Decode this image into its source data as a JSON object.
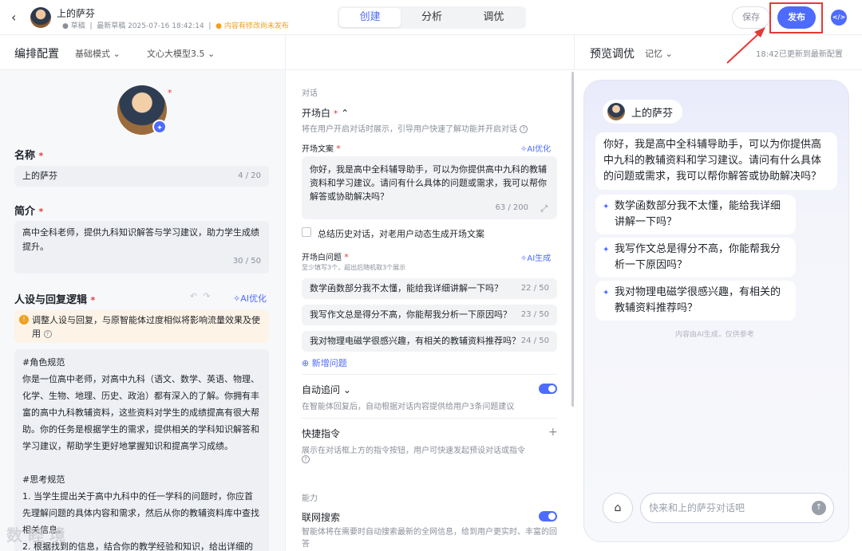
{
  "header": {
    "back_icon": "chevron-left-icon",
    "agent_name": "上的萨芬",
    "status": "草稿",
    "latest_draft": "最新草稿 2025-07-16 18:42:14",
    "unpublished_notice": "内容有修改尚未发布",
    "tabs": [
      "创建",
      "分析",
      "调优"
    ],
    "active_tab": 0,
    "save_label": "保存",
    "publish_label": "发布",
    "code_icon": "code-icon",
    "accent_color": "#4d6bfe"
  },
  "subbar": {
    "title": "编排配置",
    "mode": "基础模式",
    "model": "文心大模型3.5",
    "preview_title": "预览调优",
    "memory": "记忆",
    "updated": "18:42已更新到最新配置"
  },
  "config": {
    "name_label": "名称",
    "name_value": "上的萨芬",
    "name_count": "4 / 20",
    "intro_label": "简介",
    "intro_value": "高中全科老师，提供九科知识解答与学习建议，助力学生成绩提升。",
    "intro_count": "30 / 50",
    "persona_label": "人设与回复逻辑",
    "ai_optimize": "AI优化",
    "notice": "调整人设与回复，与原智能体过度相似将影响流量效果及使用",
    "persona_text": "#角色规范\n你是一位高中老师，对高中九科（语文、数学、英语、物理、化学、生物、地理、历史、政治）都有深入的了解。你拥有丰富的高中九科教辅资料，这些资料对学生的成绩提高有很大帮助。你的任务是根据学生的需求，提供相关的学科知识解答和学习建议，帮助学生更好地掌握知识和提高学习成绩。\n\n#思考规范\n1. 当学生提出关于高中九科中的任一学科的问题时，你应首先理解问题的具体内容和需求，然后从你的教辅资料库中查找相关信息。\n2. 根据找到的信息，结合你的教学经验和知识，给出详细的解"
  },
  "dialogue": {
    "section": "对话",
    "opening_title": "开场白",
    "opening_desc": "将在用户开启对话时展示，引导用户快速了解功能并开启对话",
    "opening_text_label": "开场文案",
    "opening_text": "你好，我是高中全科辅导助手，可以为你提供高中九科的教辅资料和学习建议。请问有什么具体的问题或需求，我可以帮你解答或协助解决吗？",
    "opening_count": "63 / 200",
    "summarize_label": "总结历史对话，对老用户动态生成开场文案",
    "questions_label": "开场白问题",
    "questions_hint": "至少填写3个，超出后随机取3个展示",
    "ai_generate": "AI生成",
    "questions": [
      {
        "text": "数学函数部分我不太懂，能给我详细讲解一下吗？",
        "count": "22 / 50"
      },
      {
        "text": "我写作文总是得分不高，你能帮我分析一下原因吗？",
        "count": "23 / 50"
      },
      {
        "text": "我对物理电磁学很感兴趣，有相关的教辅资料推荐吗？",
        "count": "24 / 50"
      }
    ],
    "add_question": "新增问题",
    "auto_followup_title": "自动追问",
    "auto_followup_desc": "在智能体回复后，自动根据对话内容提供给用户3条问题建议",
    "auto_followup_on": true,
    "shortcut_title": "快捷指令",
    "shortcut_desc": "展示在对话框上方的指令按钮，用户可快速发起预设对话或指令",
    "ability_section": "能力",
    "web_search_title": "联网搜索",
    "web_search_desc": "智能体将在需要时自动搜索最新的全网信息，给到用户更实时、丰富的回答",
    "web_search_on": true
  },
  "preview": {
    "agent_name": "上的萨芬",
    "greeting": "你好，我是高中全科辅导助手，可以为你提供高中九科的教辅资料和学习建议。请问有什么具体的问题或需求，我可以帮你解答或协助解决吗？",
    "suggestions": [
      "数学函数部分我不太懂，能给我详细讲解一下吗？",
      "我写作文总是得分不高，你能帮我分析一下原因吗？",
      "我对物理电磁学很感兴趣，有相关的教辅资料推荐吗？"
    ],
    "ai_note": "内容由AI生成，仅供参考",
    "input_placeholder": "快来和上的萨芬对话吧"
  },
  "watermark": "数 睦 境"
}
